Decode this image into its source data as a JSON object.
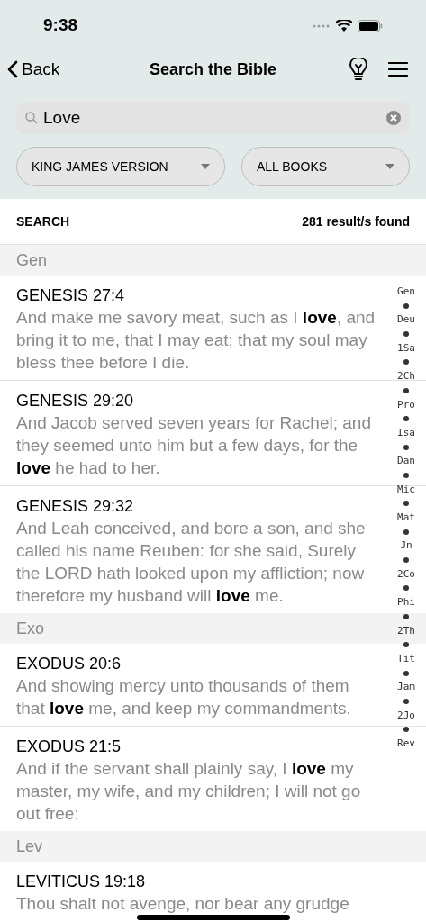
{
  "status_bar": {
    "time": "9:38"
  },
  "nav": {
    "back": "Back",
    "title": "Search the Bible"
  },
  "search": {
    "value": "Love"
  },
  "filters": [
    {
      "label": "KING JAMES VERSION"
    },
    {
      "label": "ALL BOOKS"
    }
  ],
  "results_header": {
    "label": "SEARCH",
    "count": "281 result/s found"
  },
  "groups": [
    {
      "header": "Gen",
      "results": [
        {
          "reference": "GENESIS 27:4",
          "text": "And make me savory meat, such as I **love**, and bring it to me, that I may eat; that my soul may bless thee before I die."
        },
        {
          "reference": "GENESIS 29:20",
          "text": "And Jacob served seven years for Rachel; and they seemed unto him but a few days, for the **love** he had to her."
        },
        {
          "reference": "GENESIS 29:32",
          "text": "And Leah conceived, and bore a son, and she called his name Reuben: for she said, Surely the LORD hath looked upon my affliction; now therefore my husband will **love** me."
        }
      ]
    },
    {
      "header": "Exo",
      "results": [
        {
          "reference": "EXODUS 20:6",
          "text": "And showing mercy unto thousands of them that **love** me, and keep my commandments."
        },
        {
          "reference": "EXODUS 21:5",
          "text": "And if the servant shall plainly say, I **love** my master, my wife, and my children; I will not go out free:"
        }
      ]
    },
    {
      "header": "Lev",
      "results": [
        {
          "reference": "LEVITICUS 19:18",
          "text": "Thou shalt not avenge, nor bear any grudge"
        }
      ]
    }
  ],
  "book_index": [
    "Gen",
    "Deu",
    "1Sa",
    "2Ch",
    "Pro",
    "Isa",
    "Dan",
    "Mic",
    "Mat",
    "Jn",
    "2Co",
    "Phi",
    "2Th",
    "Tit",
    "Jam",
    "2Jo",
    "Rev"
  ]
}
